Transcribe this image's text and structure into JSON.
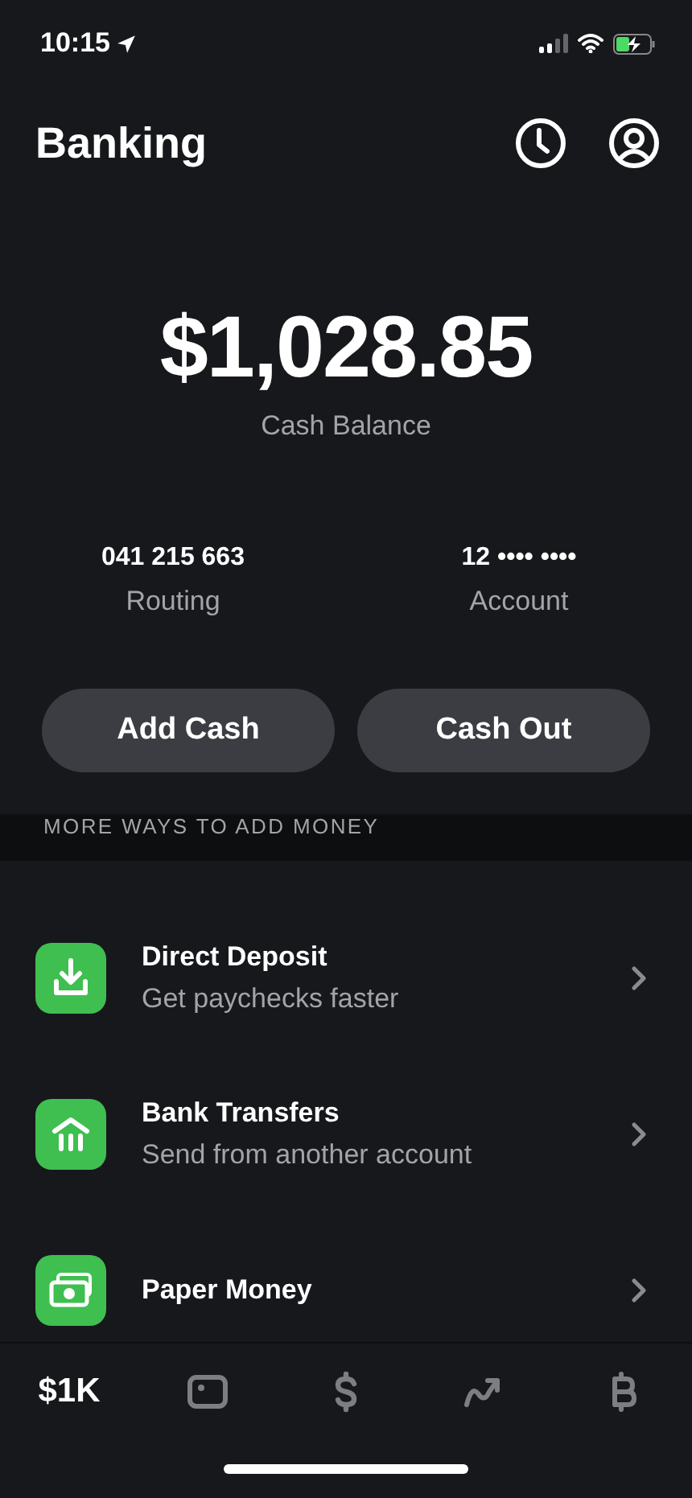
{
  "status_bar": {
    "time": "10:15"
  },
  "header": {
    "title": "Banking"
  },
  "balance": {
    "amount": "$1,028.85",
    "label": "Cash Balance"
  },
  "account_info": [
    {
      "value": "041 215 663",
      "label": "Routing"
    },
    {
      "value": "12 •••• ••••",
      "label": "Account"
    }
  ],
  "buttons": [
    "Add Cash",
    "Cash Out"
  ],
  "section": {
    "title": "MORE WAYS TO ADD MONEY",
    "items": [
      {
        "title": "Direct Deposit",
        "subtitle": "Get paychecks faster"
      },
      {
        "title": "Bank Transfers",
        "subtitle": "Send from another account"
      },
      {
        "title": "Paper Money"
      }
    ]
  },
  "tab_bar": [
    {
      "kind": "text",
      "label": "$1K",
      "selected": true
    },
    {
      "kind": "icon",
      "selected": false
    },
    {
      "kind": "icon",
      "selected": false
    },
    {
      "kind": "icon",
      "selected": false
    },
    {
      "kind": "icon",
      "selected": false
    }
  ]
}
